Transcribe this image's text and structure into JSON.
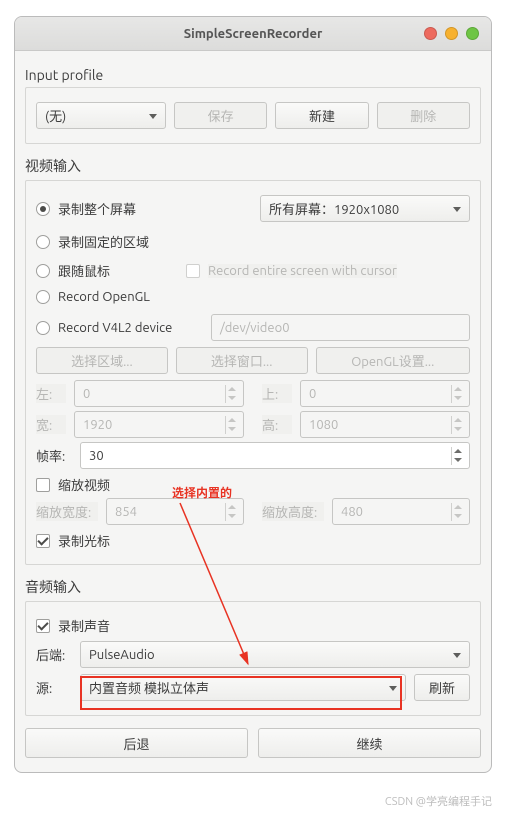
{
  "window": {
    "title": "SimpleScreenRecorder"
  },
  "profile": {
    "label": "Input profile",
    "select_value": "(无)",
    "save": "保存",
    "new": "新建",
    "delete": "删除"
  },
  "video": {
    "label": "视频输入",
    "opt_fullscreen": "录制整个屏幕",
    "screens_select": "所有屏幕：1920x1080",
    "opt_fixed": "录制固定的区域",
    "opt_follow": "跟随鼠标",
    "cursor_checkbox": "Record entire screen with cursor",
    "opt_opengl": "Record OpenGL",
    "opt_v4l2": "Record V4L2 device",
    "v4l2_device": "/dev/video0",
    "btn_select_region": "选择区域...",
    "btn_select_window": "选择窗口...",
    "btn_opengl_settings": "OpenGL设置...",
    "left_label": "左:",
    "left_value": "0",
    "top_label": "上:",
    "top_value": "0",
    "width_label": "宽:",
    "width_value": "1920",
    "height_label": "高:",
    "height_value": "1080",
    "fps_label": "帧率:",
    "fps_value": "30",
    "scale_label": "缩放视频",
    "scale_w_label": "缩放宽度:",
    "scale_w_value": "854",
    "scale_h_label": "缩放高度:",
    "scale_h_value": "480",
    "record_cursor": "录制光标"
  },
  "audio": {
    "label": "音频输入",
    "record_audio": "录制声音",
    "backend_label": "后端:",
    "backend_value": "PulseAudio",
    "source_label": "源:",
    "source_value": "内置音频 模拟立体声",
    "refresh": "刷新"
  },
  "footer": {
    "back": "后退",
    "continue": "继续"
  },
  "annotation": {
    "text": "选择内置的"
  },
  "watermark": "CSDN @学亮编程手记"
}
